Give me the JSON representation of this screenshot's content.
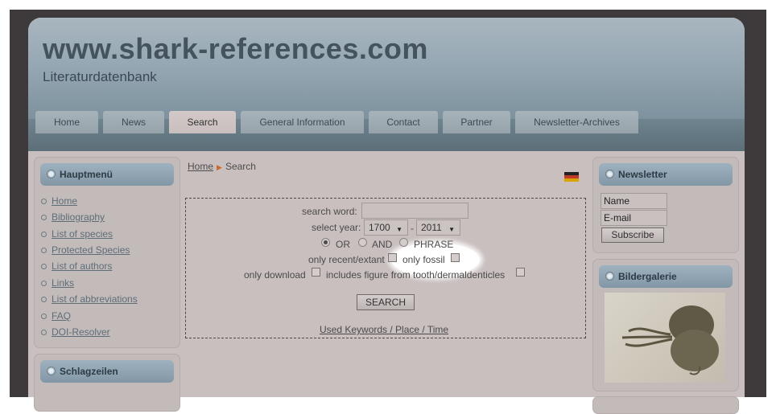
{
  "site": {
    "title": "www.shark-references.com",
    "subtitle": "Literaturdatenbank"
  },
  "nav": {
    "tabs": [
      {
        "label": "Home"
      },
      {
        "label": "News"
      },
      {
        "label": "Search",
        "active": true
      },
      {
        "label": "General Information"
      },
      {
        "label": "Contact"
      },
      {
        "label": "Partner"
      },
      {
        "label": "Newsletter-Archives"
      }
    ]
  },
  "left": {
    "main_menu": {
      "title": "Hauptmenü",
      "items": [
        "Home",
        "Bibliography",
        "List of species",
        "Protected Species",
        "List of authors",
        "Links",
        "List of abbreviations",
        "FAQ",
        "DOI-Resolver"
      ]
    },
    "headlines": {
      "title": "Schlagzeilen"
    }
  },
  "breadcrumb": {
    "home": "Home",
    "current": "Search"
  },
  "language_flag": "german-flag-icon",
  "search": {
    "search_word_label": "search word:",
    "search_word_value": "",
    "year_label": "select year:",
    "year_from": "1700",
    "year_separator": "-",
    "year_to": "2011",
    "modes": [
      {
        "label": "OR",
        "checked": true
      },
      {
        "label": "AND",
        "checked": false
      },
      {
        "label": "PHRASE",
        "checked": false
      }
    ],
    "only_recent_label": "only recent/extant",
    "only_fossil_label": "only fossil",
    "only_download_label": "only download",
    "figure_label": "includes figure from tooth/dermaldenticles",
    "button_label": "SEARCH",
    "keywords_link": "Used Keywords / Place / Time"
  },
  "right": {
    "newsletter": {
      "title": "Newsletter",
      "name_placeholder": "Name",
      "email_placeholder": "E-mail",
      "subscribe_label": "Subscribe"
    },
    "gallery": {
      "title": "Bildergalerie"
    }
  },
  "colors": {
    "header": "#96a8b4",
    "navbar": "#5c6f79",
    "page_bg": "#c8bfbe",
    "accent_arrow": "#c86a2c"
  }
}
